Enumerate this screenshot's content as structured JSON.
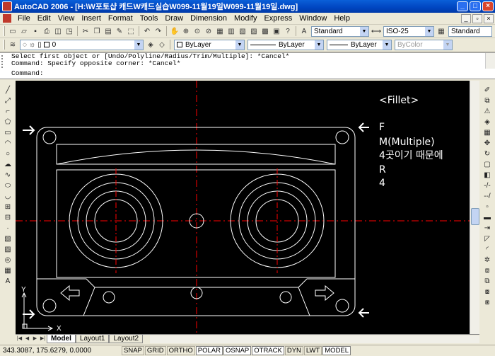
{
  "window": {
    "title": "AutoCAD 2006 - [H:\\W포토샵 캐드W캐드실습W099-11월19일W099-11월19일.dwg]"
  },
  "menu": [
    "File",
    "Edit",
    "View",
    "Insert",
    "Format",
    "Tools",
    "Draw",
    "Dimension",
    "Modify",
    "Express",
    "Window",
    "Help"
  ],
  "toolbar": {
    "text_style": "Standard",
    "dim_style": "ISO-25",
    "table_style": "Standard",
    "layer": "0",
    "color": "ByLayer",
    "linetype": "ByLayer",
    "lineweight": "ByLayer",
    "plot_style": "ByColor"
  },
  "command": {
    "history": [
      "Select first object or [Undo/Polyline/Radius/Trim/Multiple]: *Cancel*",
      "Command: Specify opposite corner: *Cancel*"
    ],
    "prompt": "Command:"
  },
  "annotation": {
    "heading": "<Fillet>",
    "lines": [
      "F",
      "M(Multiple)",
      "4곳이기 때문에",
      "R",
      "4"
    ]
  },
  "ucs": {
    "x_label": "X",
    "y_label": "Y"
  },
  "layout_tabs": [
    "Model",
    "Layout1",
    "Layout2"
  ],
  "status": {
    "coordinates": "343.3087, 175.6279, 0.0000",
    "toggles": [
      {
        "label": "SNAP",
        "on": false
      },
      {
        "label": "GRID",
        "on": false
      },
      {
        "label": "ORTHO",
        "on": false
      },
      {
        "label": "POLAR",
        "on": true
      },
      {
        "label": "OSNAP",
        "on": true
      },
      {
        "label": "OTRACK",
        "on": true
      },
      {
        "label": "DYN",
        "on": false
      },
      {
        "label": "LWT",
        "on": false
      },
      {
        "label": "MODEL",
        "on": true
      }
    ]
  },
  "colors": {
    "background": "#000000",
    "geometry": "#ffffff",
    "centerline": "#ff0000"
  }
}
